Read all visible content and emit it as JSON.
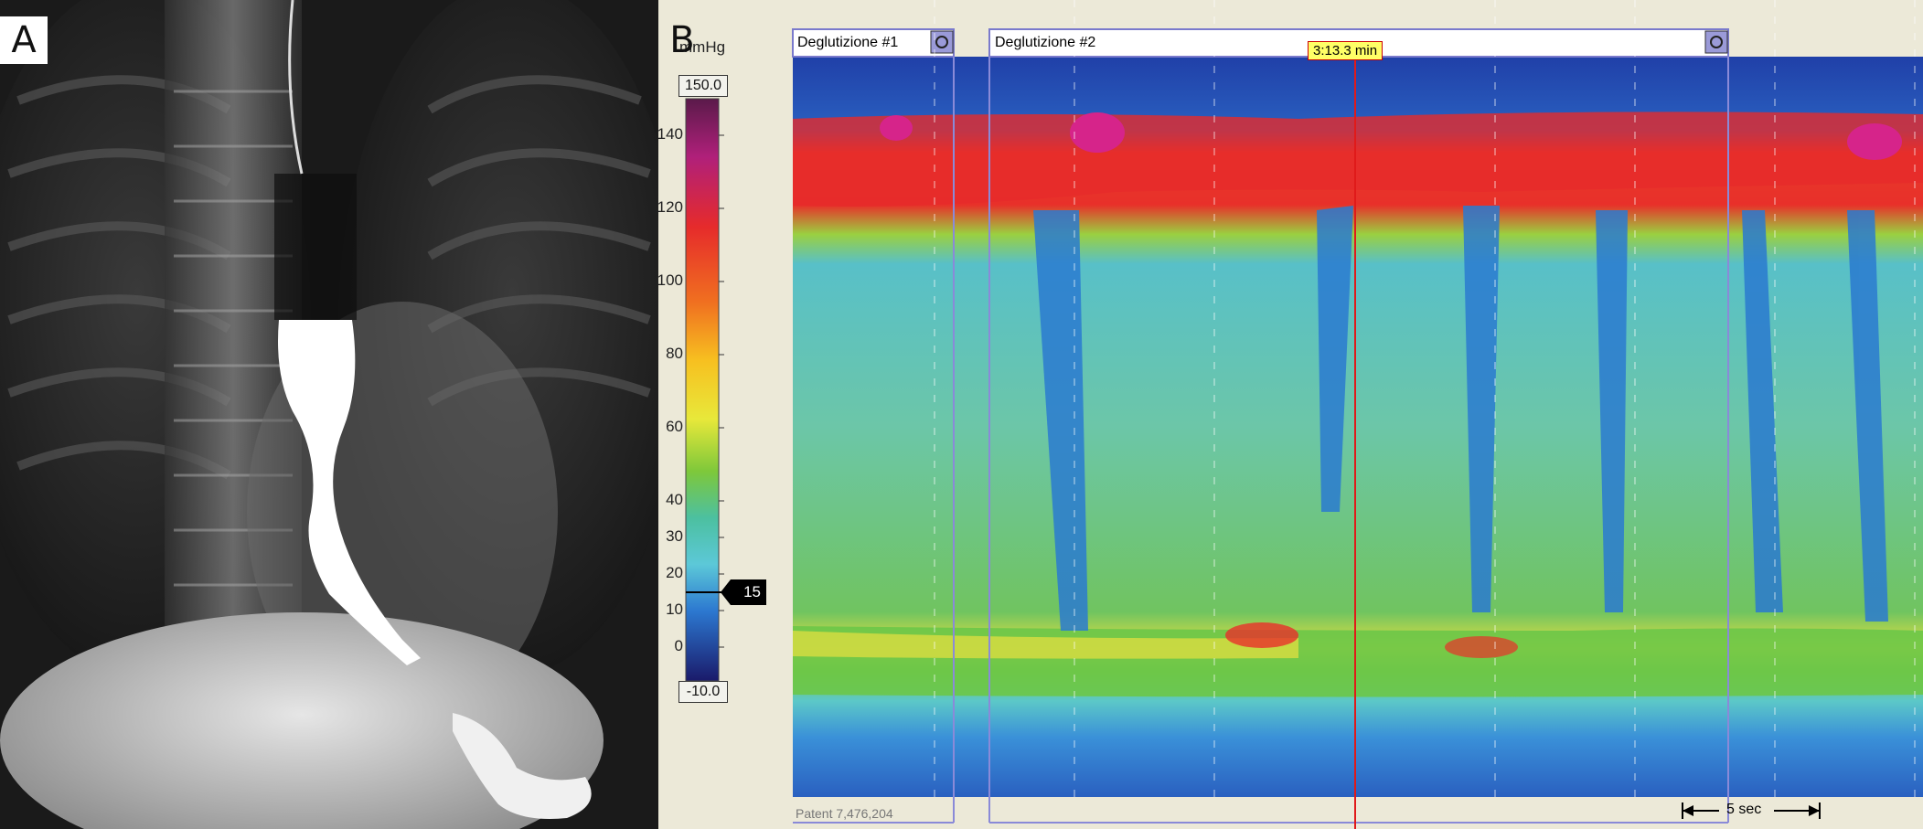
{
  "panels": {
    "a_label": "A",
    "b_label": "B"
  },
  "scale": {
    "unit": "mmHg",
    "max_box": "150.0",
    "min_box": "-10.0",
    "ticks": [
      "140",
      "120",
      "100",
      "80",
      "60",
      "40",
      "30",
      "20",
      "10",
      "0"
    ],
    "marker": "15"
  },
  "plot": {
    "swallow_1": "Deglutizione #1",
    "swallow_2": "Deglutizione #2",
    "time_badge": "3:13.3 min",
    "patent": "Patent 7,476,204",
    "scale_bar": "5 sec"
  },
  "colors": {
    "high_pressure": "#e8202a",
    "peak_pressure": "#d6248a",
    "mid_pressure": "#5ab842",
    "low_pressure": "#3a8fd8",
    "baseline": "#5cc8c8",
    "background_band": "#2040a8"
  }
}
